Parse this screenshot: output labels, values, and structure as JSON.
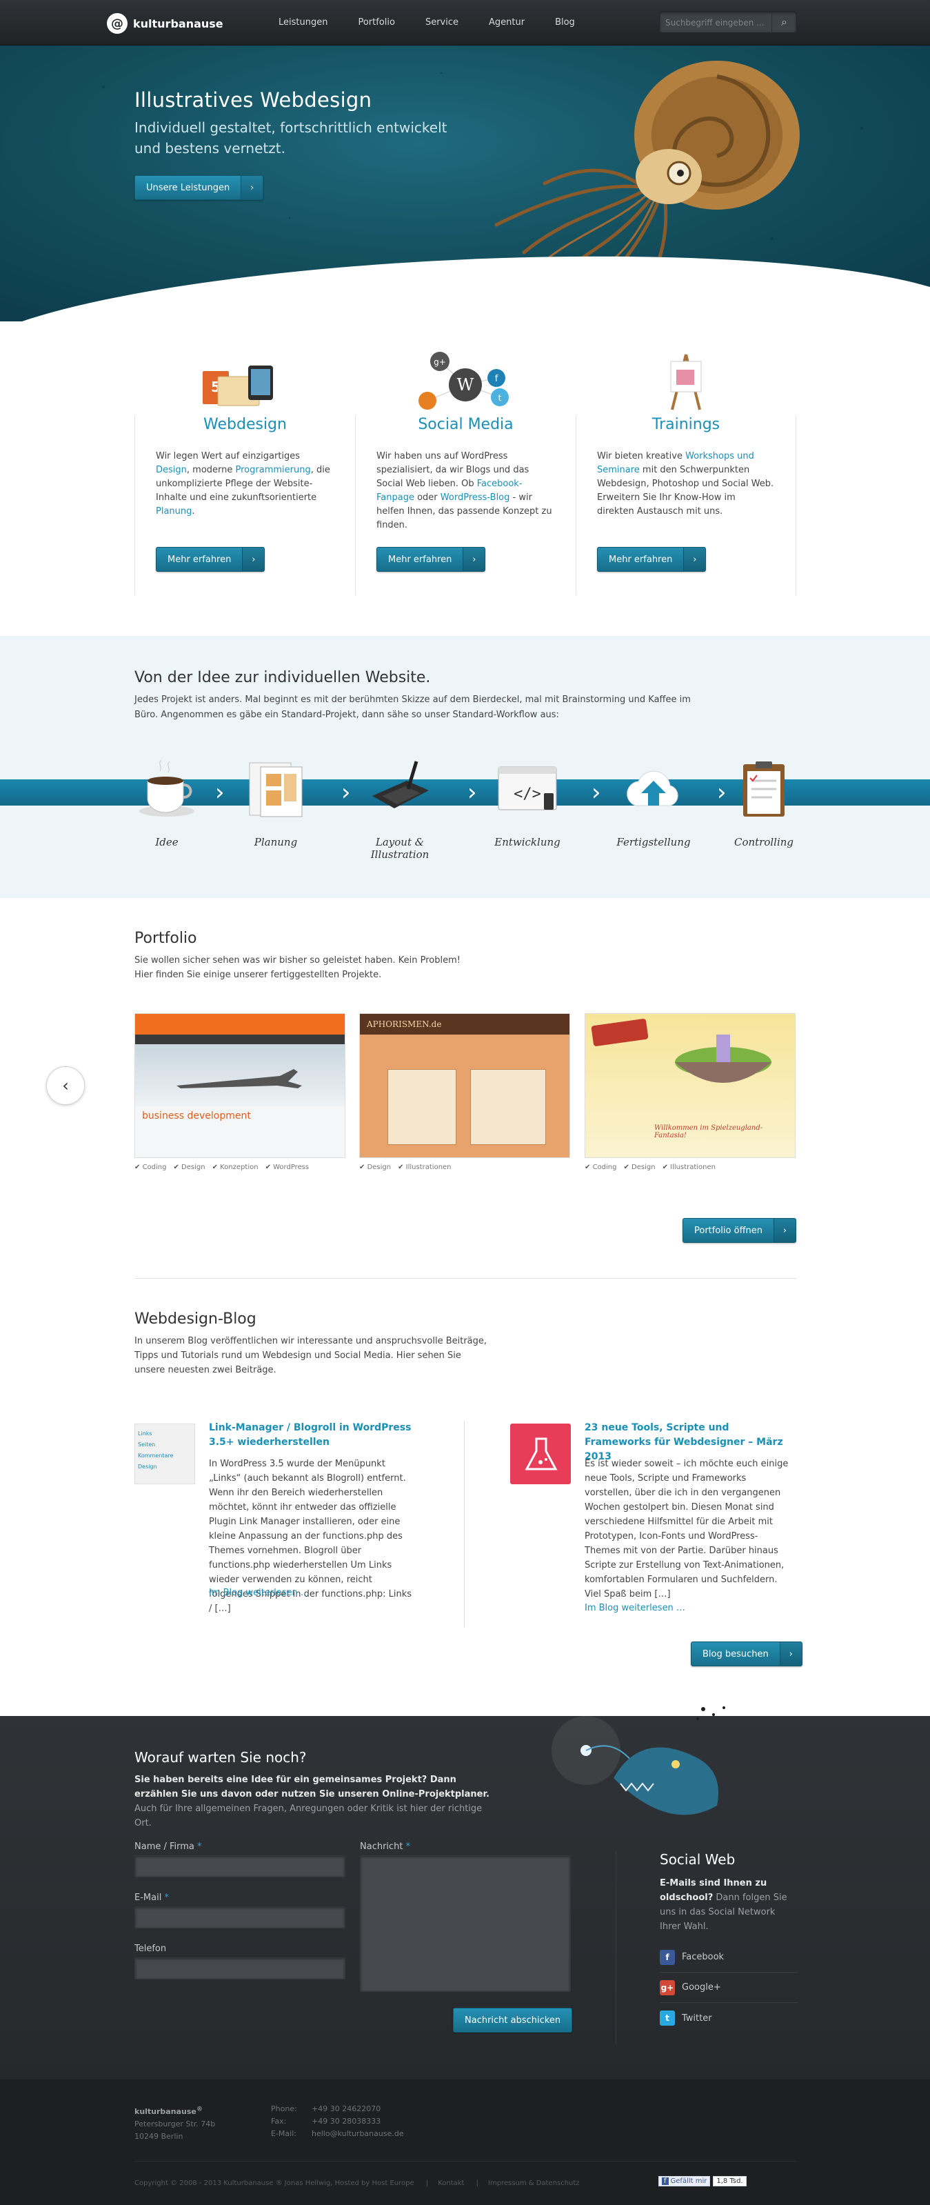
{
  "header": {
    "logo_text": "kulturbanause",
    "nav": [
      "Leistungen",
      "Portfolio",
      "Service",
      "Agentur",
      "Blog"
    ],
    "search_placeholder": "Suchbegriff eingeben ..."
  },
  "hero": {
    "title": "Illustratives Webdesign",
    "subtitle": "Individuell gestaltet, fortschrittlich entwickelt und bestens vernetzt.",
    "button": "Unsere Leistungen"
  },
  "services": [
    {
      "title": "Webdesign",
      "text_parts": [
        "Wir legen Wert auf einzigartiges ",
        "Design",
        ", moderne ",
        "Programmierung",
        ", die unkomplizierte Pflege der Website-Inhalte und eine zukunftsorientierte ",
        "Planung",
        "."
      ],
      "button": "Mehr erfahren"
    },
    {
      "title": "Social Media",
      "text_parts": [
        "Wir haben uns auf WordPress spezialisiert, da wir Blogs und das Social Web lieben. Ob ",
        "Facebook-Fanpage",
        " oder ",
        "WordPress-Blog",
        " - wir helfen Ihnen, das passende Konzept zu finden.",
        "",
        ""
      ],
      "button": "Mehr erfahren"
    },
    {
      "title": "Trainings",
      "text_parts": [
        "Wir bieten kreative ",
        "Workshops und Seminare",
        " mit den Schwerpunkten Webdesign, Photoshop und Social Web. Erweitern Sie Ihr Know-How im direkten Austausch mit uns.",
        "",
        "",
        "",
        ""
      ],
      "button": "Mehr erfahren"
    }
  ],
  "workflow": {
    "title": "Von der Idee zur individuellen Website.",
    "text": "Jedes Projekt ist anders. Mal beginnt es mit der berühmten Skizze auf dem Bierdeckel, mal mit Brainstorming und Kaffee im Büro. Angenommen es gäbe ein Standard-Projekt, dann sähe so unser Standard-Workflow aus:",
    "steps": [
      "Idee",
      "Planung",
      "Layout & Illustration",
      "Entwicklung",
      "Fertigstellung",
      "Controlling"
    ]
  },
  "portfolio": {
    "title": "Portfolio",
    "text": "Sie wollen sicher sehen was wir bisher so geleistet haben. Kein Problem! Hier finden Sie einige unserer fertiggestellten Projekte.",
    "items": [
      {
        "tags": [
          "Coding",
          "Design",
          "Konzeption",
          "WordPress"
        ],
        "caption": "business development"
      },
      {
        "tags": [
          "Design",
          "Illustrationen"
        ],
        "caption": "APHORISMEN.de"
      },
      {
        "tags": [
          "Coding",
          "Design",
          "Illustrationen"
        ],
        "caption": "Willkommen im Spielzeugland-Fantasia!"
      }
    ],
    "button": "Portfolio öffnen"
  },
  "blog": {
    "title": "Webdesign-Blog",
    "text": "In unserem Blog veröffentlichen wir interessante und anspruchsvolle Beiträge, Tipps und Tutorials rund um Webdesign und Social Media. Hier sehen Sie unsere neuesten zwei Beiträge.",
    "posts": [
      {
        "title": "Link-Manager / Blogroll in WordPress 3.5+ wiederherstellen",
        "text": "In WordPress 3.5 wurde der Menüpunkt „Links“ (auch bekannt als Blogroll) entfernt. Wenn ihr den Bereich wiederherstellen möchtet, könnt ihr entweder das offizielle Plugin Link Manager installieren, oder eine kleine Anpassung an der functions.php des Themes vornehmen. Blogroll über functions.php wiederherstellen Um Links wieder verwenden zu können, reicht folgendes Snippet in der functions.php: Links / […]",
        "more": "Im Blog weiterlesen …",
        "thumb_items": [
          "Links",
          "Seiten",
          "Kommentare",
          "Design"
        ]
      },
      {
        "title": "23 neue Tools, Scripte und Frameworks für Webdesigner – März 2013",
        "text": "Es ist wieder soweit – ich möchte euch einige neue Tools, Scripte und Frameworks vorstellen, über die ich in den vergangenen Wochen gestolpert bin. Diesen Monat sind verschiedene Hilfsmittel für die Arbeit mit Prototypen, Icon-Fonts und WordPress-Themes mit von der Partie. Darüber hinaus Scripte zur Erstellung von Text-Animationen, komfortablen Formularen und Suchfeldern. Viel Spaß beim […]",
        "more": "Im Blog weiterlesen …"
      }
    ],
    "button": "Blog besuchen"
  },
  "contact": {
    "title": "Worauf warten Sie noch?",
    "intro_bold": "Sie haben bereits eine Idee für ein gemeinsames Projekt? Dann erzählen Sie uns davon oder nutzen Sie unseren Online-Projektplaner.",
    "intro_rest": " Auch für Ihre allgemeinen Fragen, Anregungen oder Kritik ist hier der richtige Ort.",
    "labels": {
      "name": "Name / Firma",
      "email": "E-Mail",
      "phone": "Telefon",
      "message": "Nachricht"
    },
    "required_mark": "*",
    "submit": "Nachricht abschicken"
  },
  "social": {
    "title": "Social Web",
    "text_bold": "E-Mails sind Ihnen zu oldschool?",
    "text_rest": " Dann folgen Sie uns in das Social Network Ihrer Wahl.",
    "items": [
      {
        "label": "Facebook",
        "color": "#3b5998",
        "icon": "facebook-icon",
        "glyph": "f"
      },
      {
        "label": "Google+",
        "color": "#d34836",
        "icon": "google-plus-icon",
        "glyph": "g+"
      },
      {
        "label": "Twitter",
        "color": "#2aa9e0",
        "icon": "twitter-icon",
        "glyph": "t"
      }
    ]
  },
  "footer": {
    "company": "kulturbanause",
    "reg": "®",
    "street": "Petersburger Str. 74b",
    "city": "10249 Berlin",
    "phone_label": "Phone:",
    "fax_label": "Fax:",
    "email_label": "E-Mail:",
    "phone": "+49 30 24622070",
    "fax": "+49 30 28038333",
    "email": "hello@kulturbanause.de",
    "copyright": "Copyright © 2008 - 2013 Kulturbanause ® Jonas Hellwig, Hosted by Host Europe",
    "links": [
      "Kontakt",
      "Impressum & Datenschutz"
    ],
    "like_label": "Gefällt mir",
    "like_count": "1,8 Tsd."
  },
  "colors": {
    "accent": "#1a8fb7",
    "dark": "#2b2e31",
    "hero": "#14505f"
  }
}
